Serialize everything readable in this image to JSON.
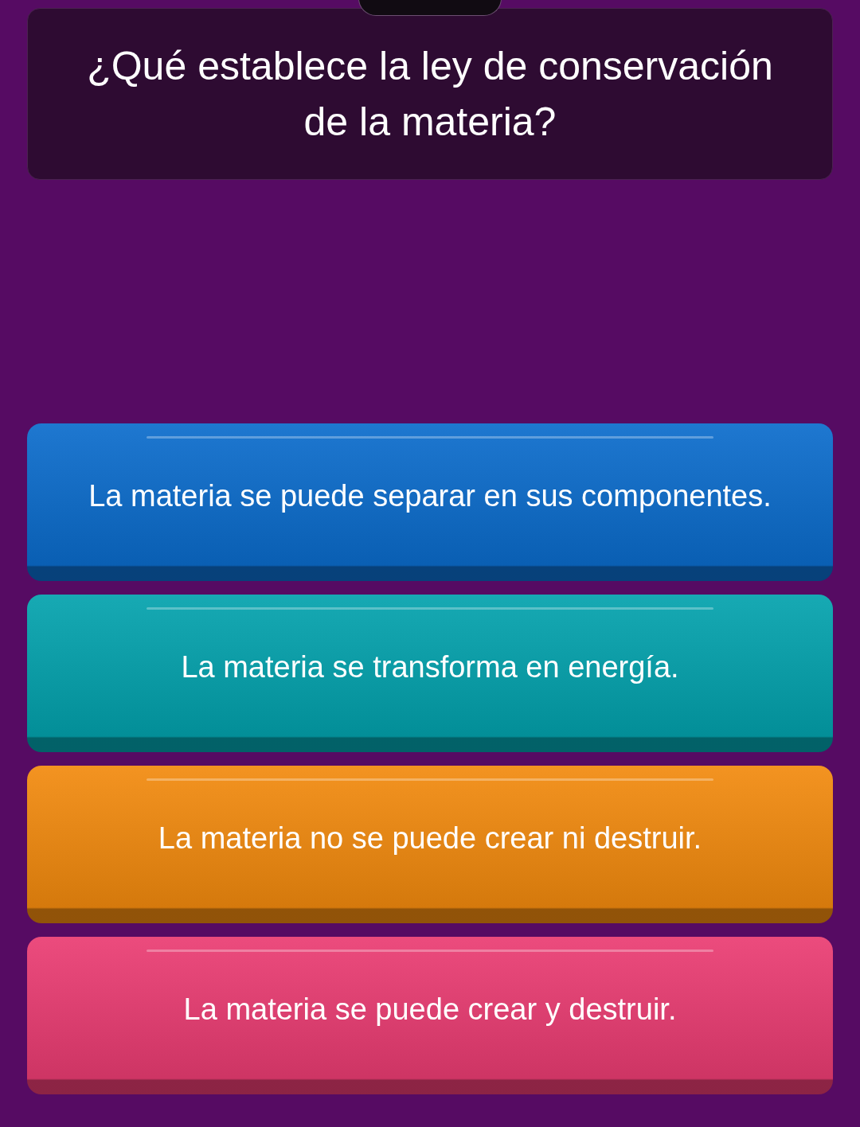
{
  "question": "¿Qué establece la ley de conservación de la materia?",
  "answers": [
    {
      "text": "La materia se puede separar en sus componentes.",
      "color": "#0b6ccc"
    },
    {
      "text": "La materia se transforma en energía.",
      "color": "#03a2ad"
    },
    {
      "text": "La materia no se puede crear ni destruir.",
      "color": "#f28a0e"
    },
    {
      "text": "La materia se puede crear y destruir.",
      "color": "#ea3c72"
    }
  ]
}
